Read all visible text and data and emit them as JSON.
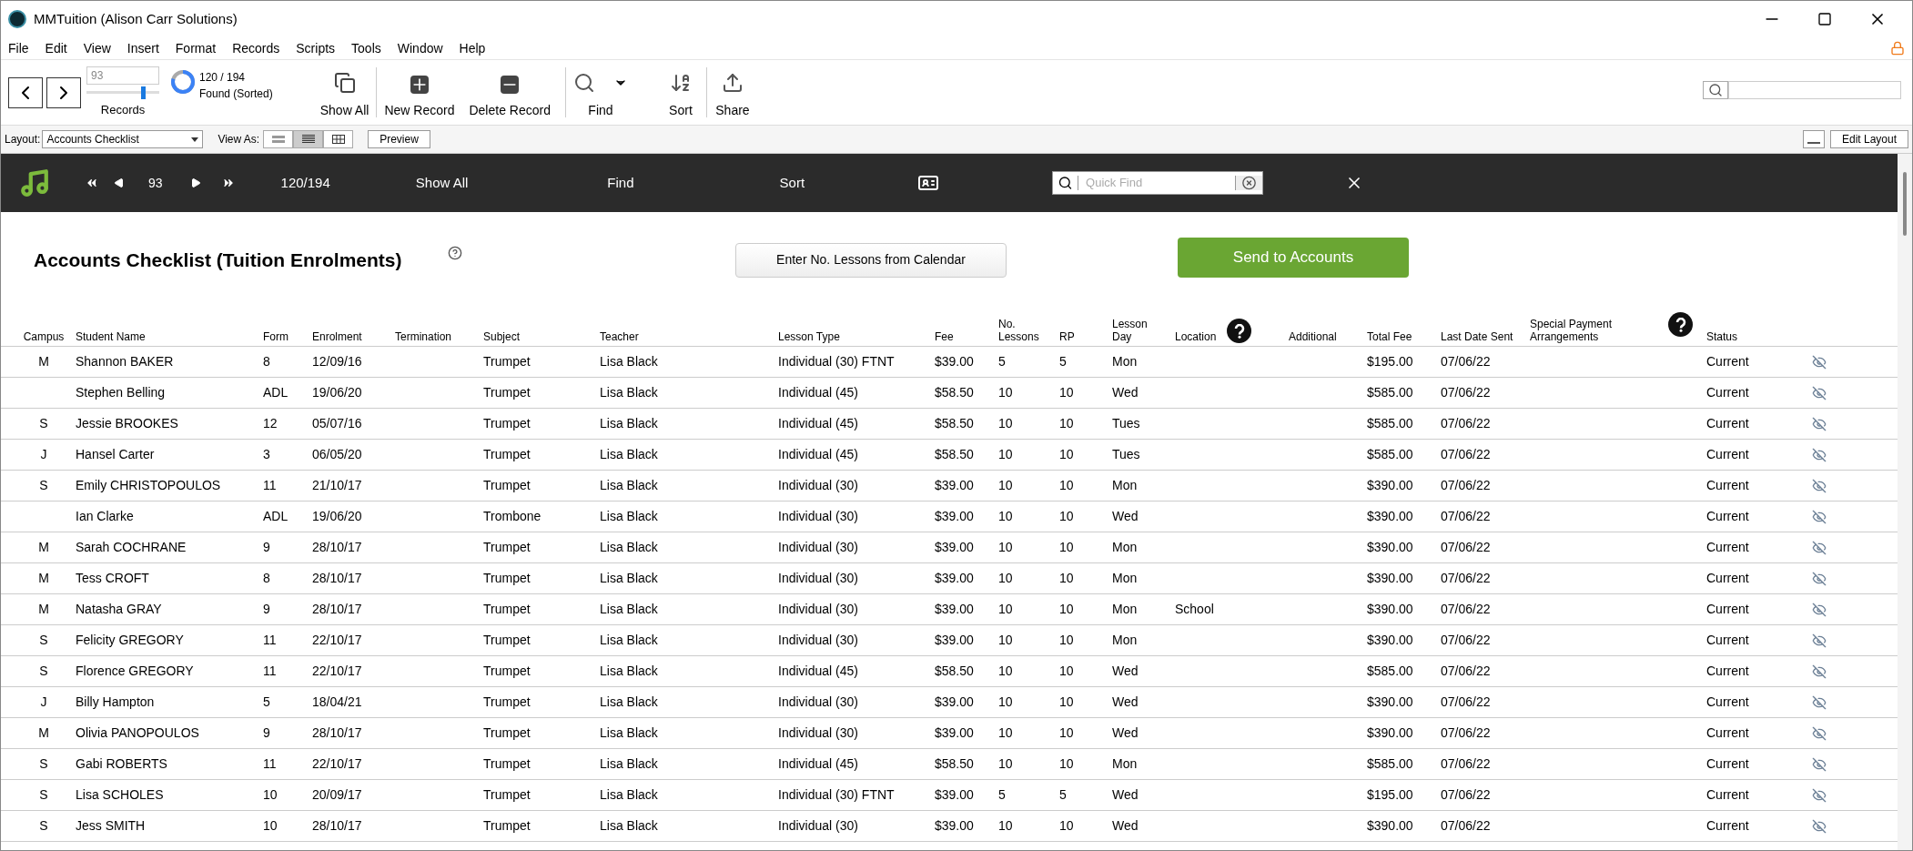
{
  "window": {
    "title": "MMTuition (Alison Carr Solutions)"
  },
  "menu": [
    "File",
    "Edit",
    "View",
    "Insert",
    "Format",
    "Records",
    "Scripts",
    "Tools",
    "Window",
    "Help"
  ],
  "toolbar": {
    "record_number": "93",
    "record_slider": {
      "level": 0.78
    },
    "records_label": "Records",
    "found_count": "120 / 194",
    "found_state": "Found (Sorted)",
    "buttons": [
      {
        "kind": "show_all",
        "label": "Show All"
      },
      {
        "kind": "new",
        "label": "New Record"
      },
      {
        "kind": "delete",
        "label": "Delete Record"
      },
      {
        "kind": "find",
        "label": "Find"
      },
      {
        "kind": "sort",
        "label": "Sort"
      },
      {
        "kind": "share",
        "label": "Share"
      }
    ]
  },
  "layout_bar": {
    "layout_label": "Layout:",
    "layout": "Accounts Checklist",
    "view_as_label": "View As:",
    "view_as": [
      {
        "kind": "form",
        "selected": false
      },
      {
        "kind": "list",
        "selected": true
      },
      {
        "kind": "table",
        "selected": false
      }
    ],
    "preview": "Preview",
    "edit_layout": "Edit Layout"
  },
  "nav_bar": {
    "record": "93",
    "count": "120/194",
    "show_all": "Show All",
    "find": "Find",
    "sort": "Sort",
    "quick_find_placeholder": "Quick Find"
  },
  "page": {
    "title": "Accounts Checklist (Tuition Enrolments)",
    "calendar_button": "Enter No. Lessons from Calendar",
    "send_button": "Send to Accounts"
  },
  "table": {
    "columns": [
      {
        "label": "Campus",
        "help": false
      },
      {
        "label": "Student Name",
        "help": false
      },
      {
        "label": "Form",
        "help": false
      },
      {
        "label": "Enrolment",
        "help": false
      },
      {
        "label": "Termination",
        "help": false
      },
      {
        "label": "Subject",
        "help": false
      },
      {
        "label": "Teacher",
        "help": false
      },
      {
        "label": "Lesson Type",
        "help": false
      },
      {
        "label": "Fee",
        "help": false
      },
      {
        "label": "No. Lessons",
        "help": false
      },
      {
        "label": "RP",
        "help": false
      },
      {
        "label": "Lesson Day",
        "help": false
      },
      {
        "label": "Location",
        "help": true
      },
      {
        "label": "Additional",
        "help": false
      },
      {
        "label": "Total Fee",
        "help": false
      },
      {
        "label": "Last Date Sent",
        "help": false
      },
      {
        "label": "Special Payment Arrangements",
        "help": true
      },
      {
        "label": "Status",
        "help": false
      }
    ],
    "rows": [
      [
        "M",
        "Shannon BAKER",
        "8",
        "12/09/16",
        "",
        "Trumpet",
        "Lisa Black",
        "Individual (30) FTNT",
        "$39.00",
        "5",
        "5",
        "Mon",
        "",
        "",
        "$195.00",
        "07/06/22",
        "",
        "Current"
      ],
      [
        "",
        "Stephen Belling",
        "ADL",
        "19/06/20",
        "",
        "Trumpet",
        "Lisa Black",
        "Individual (45)",
        "$58.50",
        "10",
        "10",
        "Wed",
        "",
        "",
        "$585.00",
        "07/06/22",
        "",
        "Current"
      ],
      [
        "S",
        "Jessie BROOKES",
        "12",
        "05/07/16",
        "",
        "Trumpet",
        "Lisa Black",
        "Individual (45)",
        "$58.50",
        "10",
        "10",
        "Tues",
        "",
        "",
        "$585.00",
        "07/06/22",
        "",
        "Current"
      ],
      [
        "J",
        "Hansel Carter",
        "3",
        "06/05/20",
        "",
        "Trumpet",
        "Lisa Black",
        "Individual (45)",
        "$58.50",
        "10",
        "10",
        "Tues",
        "",
        "",
        "$585.00",
        "07/06/22",
        "",
        "Current"
      ],
      [
        "S",
        "Emily CHRISTOPOULOS",
        "11",
        "21/10/17",
        "",
        "Trumpet",
        "Lisa Black",
        "Individual (30)",
        "$39.00",
        "10",
        "10",
        "Mon",
        "",
        "",
        "$390.00",
        "07/06/22",
        "",
        "Current"
      ],
      [
        "",
        "Ian Clarke",
        "ADL",
        "19/06/20",
        "",
        "Trombone",
        "Lisa Black",
        "Individual (30)",
        "$39.00",
        "10",
        "10",
        "Wed",
        "",
        "",
        "$390.00",
        "07/06/22",
        "",
        "Current"
      ],
      [
        "M",
        "Sarah COCHRANE",
        "9",
        "28/10/17",
        "",
        "Trumpet",
        "Lisa Black",
        "Individual (30)",
        "$39.00",
        "10",
        "10",
        "Mon",
        "",
        "",
        "$390.00",
        "07/06/22",
        "",
        "Current"
      ],
      [
        "M",
        "Tess CROFT",
        "8",
        "28/10/17",
        "",
        "Trumpet",
        "Lisa Black",
        "Individual (30)",
        "$39.00",
        "10",
        "10",
        "Mon",
        "",
        "",
        "$390.00",
        "07/06/22",
        "",
        "Current"
      ],
      [
        "M",
        "Natasha GRAY",
        "9",
        "28/10/17",
        "",
        "Trumpet",
        "Lisa Black",
        "Individual (30)",
        "$39.00",
        "10",
        "10",
        "Mon",
        "School",
        "",
        "$390.00",
        "07/06/22",
        "",
        "Current"
      ],
      [
        "S",
        "Felicity GREGORY",
        "11",
        "22/10/17",
        "",
        "Trumpet",
        "Lisa Black",
        "Individual (30)",
        "$39.00",
        "10",
        "10",
        "Mon",
        "",
        "",
        "$390.00",
        "07/06/22",
        "",
        "Current"
      ],
      [
        "S",
        "Florence GREGORY",
        "11",
        "22/10/17",
        "",
        "Trumpet",
        "Lisa Black",
        "Individual (45)",
        "$58.50",
        "10",
        "10",
        "Wed",
        "",
        "",
        "$585.00",
        "07/06/22",
        "",
        "Current"
      ],
      [
        "J",
        "Billy Hampton",
        "5",
        "18/04/21",
        "",
        "Trumpet",
        "Lisa Black",
        "Individual (30)",
        "$39.00",
        "10",
        "10",
        "Wed",
        "",
        "",
        "$390.00",
        "07/06/22",
        "",
        "Current"
      ],
      [
        "M",
        "Olivia PANOPOULOS",
        "9",
        "28/10/17",
        "",
        "Trumpet",
        "Lisa Black",
        "Individual (30)",
        "$39.00",
        "10",
        "10",
        "Wed",
        "",
        "",
        "$390.00",
        "07/06/22",
        "",
        "Current"
      ],
      [
        "S",
        "Gabi ROBERTS",
        "11",
        "22/10/17",
        "",
        "Trumpet",
        "Lisa Black",
        "Individual (45)",
        "$58.50",
        "10",
        "10",
        "Mon",
        "",
        "",
        "$585.00",
        "07/06/22",
        "",
        "Current"
      ],
      [
        "S",
        "Lisa SCHOLES",
        "10",
        "20/09/17",
        "",
        "Trumpet",
        "Lisa Black",
        "Individual (30) FTNT",
        "$39.00",
        "5",
        "5",
        "Wed",
        "",
        "",
        "$195.00",
        "07/06/22",
        "",
        "Current"
      ],
      [
        "S",
        "Jess SMITH",
        "10",
        "28/10/17",
        "",
        "Trumpet",
        "Lisa Black",
        "Individual (30)",
        "$39.00",
        "10",
        "10",
        "Wed",
        "",
        "",
        "$390.00",
        "07/06/22",
        "",
        "Current"
      ]
    ]
  }
}
